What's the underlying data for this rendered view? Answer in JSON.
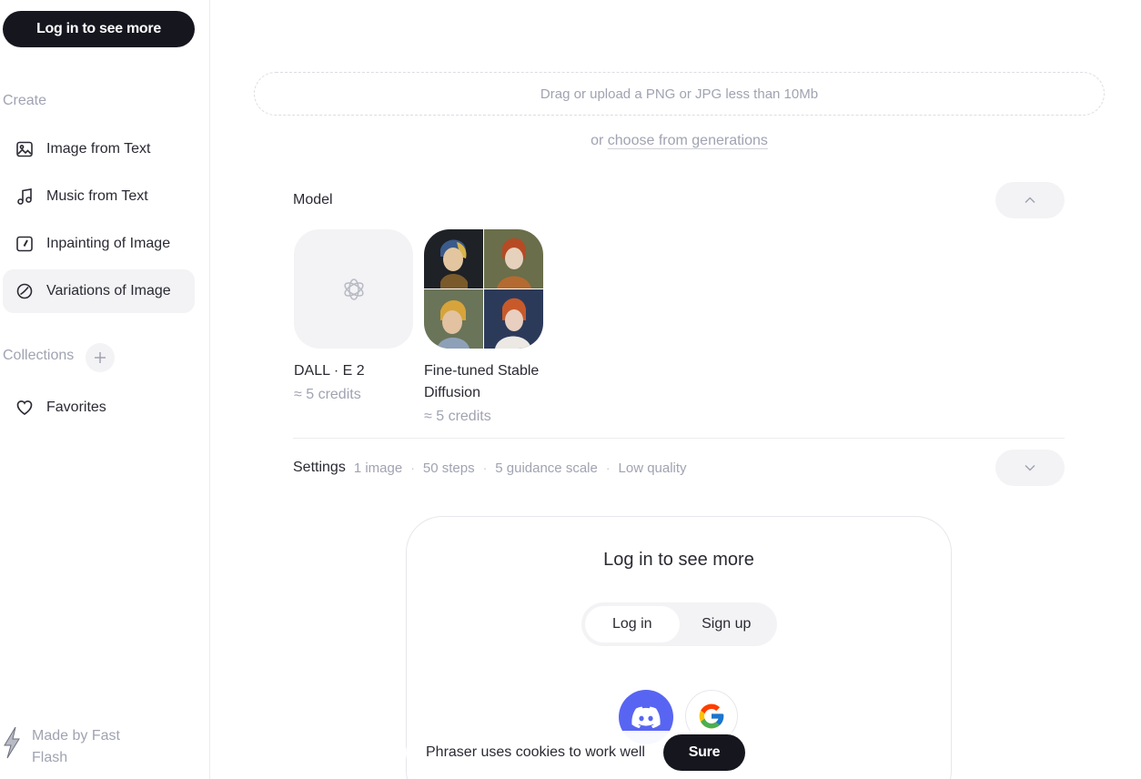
{
  "sidebar": {
    "login_button": "Log in to see more",
    "create_label": "Create",
    "items": [
      {
        "label": "Image from Text",
        "icon": "image-icon"
      },
      {
        "label": "Music from Text",
        "icon": "music-note-icon"
      },
      {
        "label": "Inpainting of Image",
        "icon": "inpainting-icon"
      },
      {
        "label": "Variations of Image",
        "icon": "variations-icon",
        "active": true
      }
    ],
    "collections_label": "Collections",
    "add_icon": "plus-icon",
    "favorites_label": "Favorites",
    "made_by": "Made by Fast Flash"
  },
  "upload": {
    "dropzone_text": "Drag or upload a PNG or JPG less than 10Mb",
    "or_text": "or",
    "choose_link": "choose from generations"
  },
  "model": {
    "label": "Model",
    "options": [
      {
        "name": "DALL · E 2",
        "credits": "≈ 5 credits",
        "icon": "openai-icon"
      },
      {
        "name": "Fine-tuned Stable Diffusion",
        "credits": "≈ 5 credits",
        "icon": "painting-grid"
      }
    ]
  },
  "settings": {
    "label": "Settings",
    "images": "1 image",
    "steps": "50 steps",
    "guidance": "5 guidance scale",
    "quality": "Low quality"
  },
  "login_card": {
    "title": "Log in to see more",
    "login_tab": "Log in",
    "signup_tab": "Sign up",
    "providers": [
      "discord-icon",
      "google-icon"
    ]
  },
  "cookie": {
    "text": "Phraser uses cookies to work well",
    "button": "Sure"
  },
  "colors": {
    "primary_dark": "#16161f",
    "muted_text": "#a0a3b1",
    "surface": "#f3f3f5",
    "discord": "#5865f2"
  }
}
